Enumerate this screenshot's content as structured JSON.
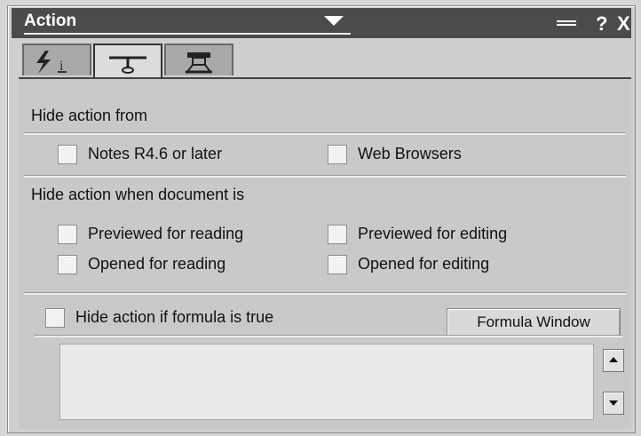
{
  "window": {
    "title": "Action",
    "controls": {
      "help_label": "?",
      "close_label": "X"
    }
  },
  "tabs": [
    {
      "icon": "lightning-icon",
      "active": false
    },
    {
      "icon": "hide-when-icon",
      "active": true
    },
    {
      "icon": "security-icon",
      "active": false
    }
  ],
  "hide_from": {
    "heading": "Hide action from",
    "options": [
      {
        "label": "Notes R4.6 or later",
        "checked": false
      },
      {
        "label": "Web Browsers",
        "checked": false
      }
    ]
  },
  "hide_when": {
    "heading": "Hide action when document is",
    "options": [
      {
        "label": "Previewed for reading",
        "checked": false
      },
      {
        "label": "Previewed for editing",
        "checked": false
      },
      {
        "label": "Opened for reading",
        "checked": false
      },
      {
        "label": "Opened for editing",
        "checked": false
      }
    ]
  },
  "formula": {
    "checkbox_label": "Hide action if formula is true",
    "checked": false,
    "button_label": "Formula Window",
    "value": ""
  }
}
